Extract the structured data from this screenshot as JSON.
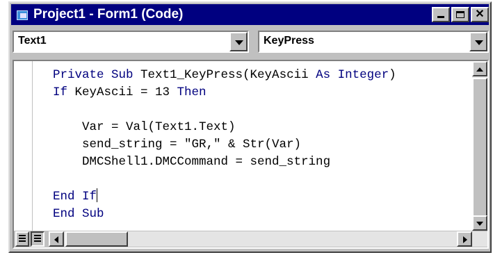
{
  "window": {
    "title": "Project1 - Form1 (Code)"
  },
  "object_combo": {
    "value": "Text1"
  },
  "procedure_combo": {
    "value": "KeyPress"
  },
  "code_lines": [
    [
      {
        "text": "Private Sub ",
        "kw": true
      },
      {
        "text": "Text1_KeyPress(KeyAscii ",
        "kw": false
      },
      {
        "text": "As Integer",
        "kw": true
      },
      {
        "text": ")",
        "kw": false
      }
    ],
    [
      {
        "text": "If ",
        "kw": true
      },
      {
        "text": "KeyAscii = 13 ",
        "kw": false
      },
      {
        "text": "Then",
        "kw": true
      }
    ],
    [],
    [
      {
        "text": "    Var = Val(Text1.Text)",
        "kw": false
      }
    ],
    [
      {
        "text": "    send_string = \"GR,\" & Str(Var)",
        "kw": false
      }
    ],
    [
      {
        "text": "    DMCShell1.DMCCommand = send_string",
        "kw": false
      }
    ],
    [],
    [
      {
        "text": "End If",
        "kw": true
      }
    ],
    [
      {
        "text": "End Sub",
        "kw": true
      }
    ]
  ],
  "icons": {
    "app": "vb-form-icon",
    "minimize": "minimize-icon",
    "maximize": "maximize-icon",
    "close": "close-icon",
    "procedure_view": "procedure-view-icon",
    "full_module_view": "full-module-view-icon"
  },
  "colors": {
    "title_bar": "#000080",
    "keyword": "#00007f",
    "face": "#c0c0c0"
  }
}
